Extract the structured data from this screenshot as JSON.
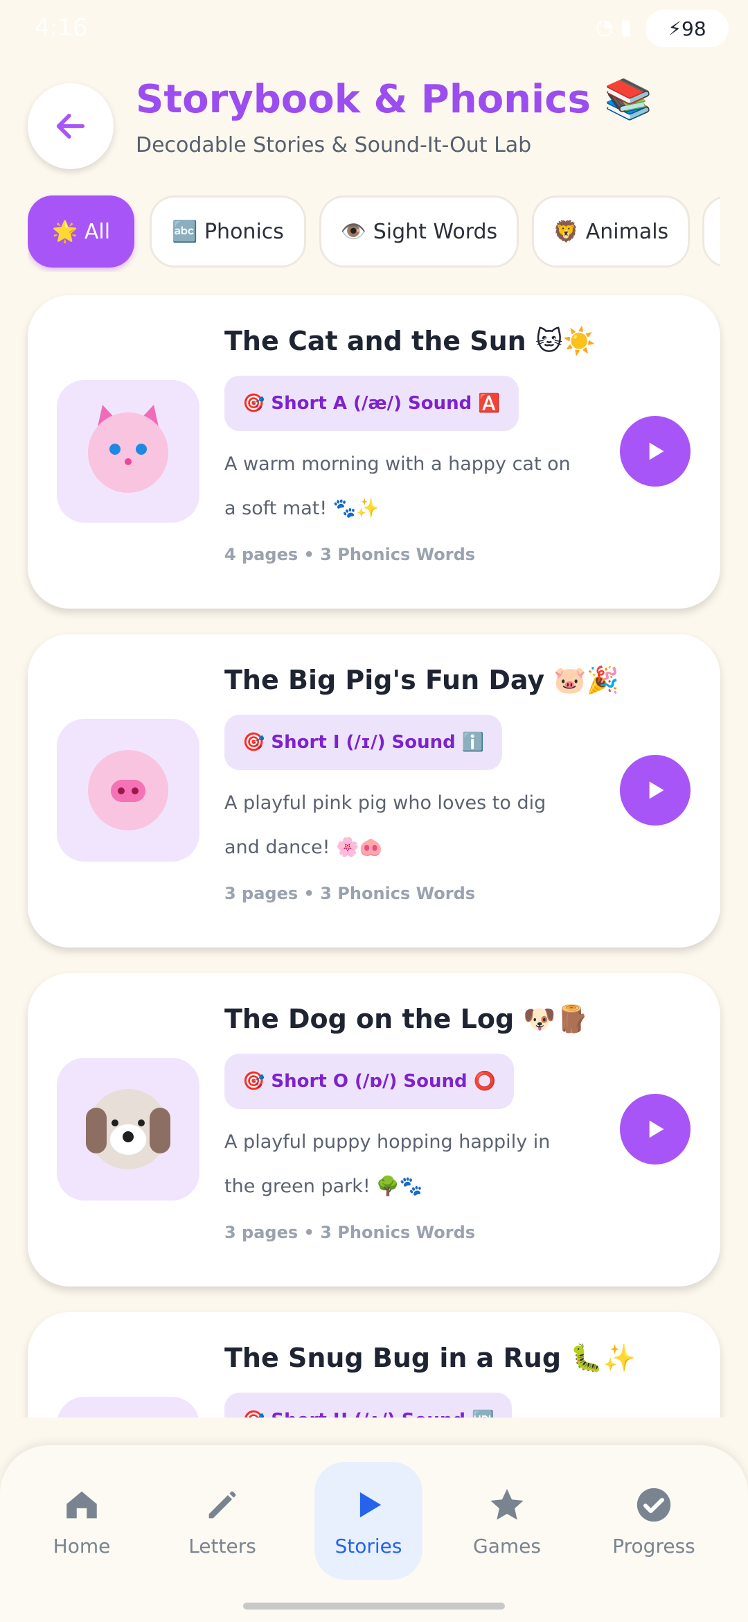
{
  "status": {
    "time": "4:16",
    "battery": "98"
  },
  "header": {
    "back_icon": "arrow-left-icon",
    "title": "Storybook & Phonics 📚",
    "subtitle": "Decodable Stories & Sound-It-Out Lab"
  },
  "filters": [
    {
      "label": "🌟 All",
      "active": true
    },
    {
      "label": "🔤 Phonics",
      "active": false
    },
    {
      "label": "👁️ Sight Words",
      "active": false
    },
    {
      "label": "🦁 Animals",
      "active": false
    }
  ],
  "stories": [
    {
      "title": "The Cat and the Sun 🐱☀️",
      "badge": "🎯 Short A (/æ/) Sound 🅰️",
      "desc": "A warm morning with a happy cat on a soft mat! 🐾✨",
      "meta": "4 pages • 3 Phonics Words",
      "thumb_icon": "cat-face-icon"
    },
    {
      "title": "The Big Pig's Fun Day 🐷🎉",
      "badge": "🎯 Short I (/ɪ/) Sound ℹ️",
      "desc": "A playful pink pig who loves to dig and dance! 🌸🐽",
      "meta": "3 pages • 3 Phonics Words",
      "thumb_icon": "pig-face-icon"
    },
    {
      "title": "The Dog on the Log 🐶🪵",
      "badge": "🎯 Short O (/ɒ/) Sound ⭕",
      "desc": "A playful puppy hopping happily in the green park! 🌳🐾",
      "meta": "3 pages • 3 Phonics Words",
      "thumb_icon": "dog-face-icon"
    },
    {
      "title": "The Snug Bug in a Rug 🐛✨",
      "badge": "🎯 Short U (/ʌ/) Sound 🆙",
      "desc": "",
      "meta": "",
      "thumb_icon": "bug-icon"
    }
  ],
  "nav": [
    {
      "label": "Home",
      "icon": "home-icon",
      "active": false
    },
    {
      "label": "Letters",
      "icon": "pencil-icon",
      "active": false
    },
    {
      "label": "Stories",
      "icon": "play-icon",
      "active": true
    },
    {
      "label": "Games",
      "icon": "star-icon",
      "active": false
    },
    {
      "label": "Progress",
      "icon": "check-circle-icon",
      "active": false
    }
  ],
  "colors": {
    "accent": "#A855F7",
    "title": "#9B4DF0",
    "nav_active": "#2563EB",
    "background": "#FDF8EE"
  }
}
